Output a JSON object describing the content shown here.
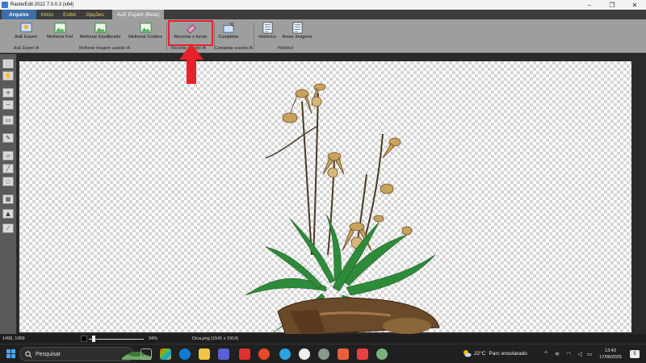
{
  "window": {
    "title": "RasterEdit 2022 7.0.0.3 (x64)"
  },
  "menu": {
    "tabs": [
      {
        "label": "Arquivo"
      },
      {
        "label": "Início"
      },
      {
        "label": "Exibir"
      },
      {
        "label": "Opções"
      },
      {
        "label": "AuE Expert (Beta)"
      }
    ]
  },
  "ribbon": {
    "buttons": [
      {
        "label": "AuE Expert"
      },
      {
        "label": "Melhorar Fiel"
      },
      {
        "label": "Melhorar Equilibrado"
      },
      {
        "label": "Melhorar Criativo"
      },
      {
        "label": "Recortar o fundo"
      },
      {
        "label": "Completar"
      },
      {
        "label": "Histórico"
      },
      {
        "label": "Rever imagens"
      }
    ],
    "groups": [
      {
        "label": "AuE Expert IA"
      },
      {
        "label": "Melhorar Imagem usando IA"
      },
      {
        "label": "Recortar usando IA"
      },
      {
        "label": "Completar usando IA"
      },
      {
        "label": "Histórico"
      }
    ]
  },
  "status": {
    "coords": "1458, 1069",
    "zoom": "34%",
    "file": "Dica.png (1541 x 1914)"
  },
  "taskbar": {
    "search_placeholder": "Pesquisar",
    "weather_temp": "22°C",
    "weather_text": "Parc ensolarado",
    "time": "13:43",
    "date": "17/06/2025",
    "notifications": "5"
  },
  "colors": {
    "accent": "#3b6fa8",
    "menu_text": "#e8d36a",
    "highlight": "#e8202a",
    "ribbon_bg": "#9e9e9e"
  }
}
